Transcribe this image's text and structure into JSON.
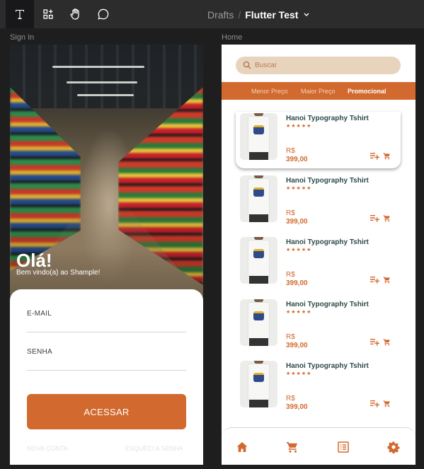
{
  "toolbar": {
    "tools": [
      "text-tool-icon",
      "components-icon",
      "hand-icon",
      "comment-icon"
    ],
    "breadcrumb": {
      "project": "Drafts",
      "separator": "/",
      "file": "Flutter Test"
    }
  },
  "frames": {
    "signin_label": "Sign In",
    "home_label": "Home"
  },
  "signin": {
    "greeting": "Olá!",
    "welcome": "Bem vindo(a) ao Shample!",
    "email_label": "E-MAIL",
    "password_label": "SENHA",
    "submit_label": "ACESSAR",
    "new_account": "NOVA CONTA",
    "forgot_password": "ESQUECI A SENHA"
  },
  "home": {
    "search_placeholder": "Buscar",
    "tabs": [
      {
        "label": "Menor Preço",
        "selected": false
      },
      {
        "label": "Maior Preço",
        "selected": false
      },
      {
        "label": "Promocional",
        "selected": true
      }
    ],
    "products": [
      {
        "name": "Hanoi Typography Tshirt",
        "rating": "★★★★★",
        "currency": "R$",
        "price": "399,00"
      },
      {
        "name": "Hanoi Typography Tshirt",
        "rating": "★★★★★",
        "currency": "R$",
        "price": "399,00"
      },
      {
        "name": "Hanoi Typography Tshirt",
        "rating": "★★★★★",
        "currency": "R$",
        "price": "399,00"
      },
      {
        "name": "Hanoi Typography Tshirt",
        "rating": "★★★★★",
        "currency": "R$",
        "price": "399,00"
      },
      {
        "name": "Hanoi Typography Tshirt",
        "rating": "★★★★★",
        "currency": "R$",
        "price": "399,00"
      }
    ],
    "bottom_nav": [
      "home-icon",
      "cart-icon",
      "orders-icon",
      "settings-icon"
    ]
  },
  "colors": {
    "accent": "#d2692e",
    "search_bg": "#e8d4bd",
    "toolbar_bg": "#2c2c2c",
    "canvas_bg": "#1e1e1e"
  }
}
